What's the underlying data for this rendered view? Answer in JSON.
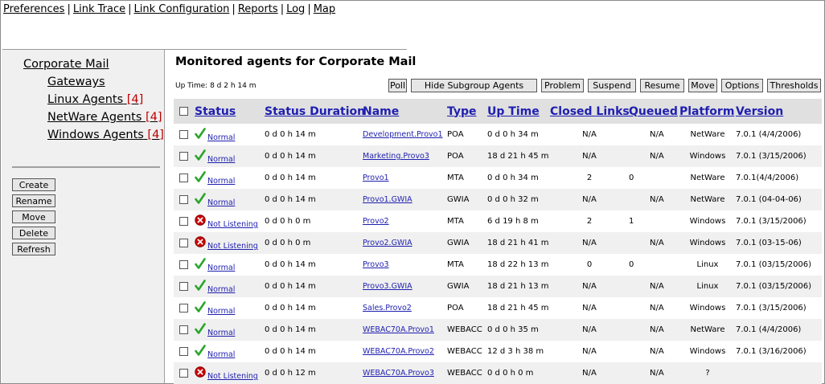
{
  "topnav": [
    "Preferences",
    "Link Trace",
    "Link Configuration",
    "Reports",
    "Log",
    "Map"
  ],
  "tree": {
    "root": "Corporate Mail",
    "children": [
      {
        "label": "Gateways",
        "count": ""
      },
      {
        "label": "Linux Agents",
        "count": "[4]"
      },
      {
        "label": "NetWare Agents",
        "count": "[4]"
      },
      {
        "label": "Windows Agents",
        "count": "[4]"
      }
    ]
  },
  "left_buttons": [
    "Create",
    "Rename",
    "Move",
    "Delete",
    "Refresh"
  ],
  "main": {
    "title": "Monitored agents for Corporate Mail",
    "uptime": "Up Time: 8 d 2 h 14 m",
    "toolbar": [
      "Poll",
      "Hide Subgroup Agents",
      "Problem",
      "Suspend",
      "Resume",
      "Move",
      "Options",
      "Thresholds"
    ]
  },
  "columns": [
    "Status",
    "Status Duration",
    "Name",
    "Type",
    "Up Time",
    "Closed Links",
    "Queued",
    "Platform",
    "Version"
  ],
  "rows": [
    {
      "status": "Normal",
      "ok": true,
      "duration": "0 d 0 h 14 m",
      "name": "Development.Provo1",
      "type": "POA",
      "uptime": "0 d 0 h 34 m",
      "closed": "N/A",
      "queued": "N/A",
      "platform": "NetWare",
      "version": "7.0.1 (4/4/2006)"
    },
    {
      "status": "Normal",
      "ok": true,
      "duration": "0 d 0 h 14 m",
      "name": "Marketing.Provo3",
      "type": "POA",
      "uptime": "18 d 21 h 45 m",
      "closed": "N/A",
      "queued": "N/A",
      "platform": "Windows",
      "version": "7.0.1 (3/15/2006)"
    },
    {
      "status": "Normal",
      "ok": true,
      "duration": "0 d 0 h 14 m",
      "name": "Provo1",
      "type": "MTA",
      "uptime": "0 d 0 h 34 m",
      "closed": "2",
      "queued": "0",
      "platform": "NetWare",
      "version": "7.0.1(4/4/2006)"
    },
    {
      "status": "Normal",
      "ok": true,
      "duration": "0 d 0 h 14 m",
      "name": "Provo1.GWIA",
      "type": "GWIA",
      "uptime": "0 d 0 h 32 m",
      "closed": "N/A",
      "queued": "N/A",
      "platform": "NetWare",
      "version": "7.0.1 (04-04-06)"
    },
    {
      "status": "Not Listening",
      "ok": false,
      "duration": "0 d 0 h 0 m",
      "name": "Provo2",
      "type": "MTA",
      "uptime": "6 d 19 h 8 m",
      "closed": "2",
      "queued": "1",
      "platform": "Windows",
      "version": "7.0.1 (3/15/2006)"
    },
    {
      "status": "Not Listening",
      "ok": false,
      "duration": "0 d 0 h 0 m",
      "name": "Provo2.GWIA",
      "type": "GWIA",
      "uptime": "18 d 21 h 41 m",
      "closed": "N/A",
      "queued": "N/A",
      "platform": "Windows",
      "version": "7.0.1 (03-15-06)"
    },
    {
      "status": "Normal",
      "ok": true,
      "duration": "0 d 0 h 14 m",
      "name": "Provo3",
      "type": "MTA",
      "uptime": "18 d 22 h 13 m",
      "closed": "0",
      "queued": "0",
      "platform": "Linux",
      "version": "7.0.1 (03/15/2006)"
    },
    {
      "status": "Normal",
      "ok": true,
      "duration": "0 d 0 h 14 m",
      "name": "Provo3.GWIA",
      "type": "GWIA",
      "uptime": "18 d 21 h 13 m",
      "closed": "N/A",
      "queued": "N/A",
      "platform": "Linux",
      "version": "7.0.1 (03/15/2006)"
    },
    {
      "status": "Normal",
      "ok": true,
      "duration": "0 d 0 h 14 m",
      "name": "Sales.Provo2",
      "type": "POA",
      "uptime": "18 d 21 h 45 m",
      "closed": "N/A",
      "queued": "N/A",
      "platform": "Windows",
      "version": "7.0.1 (3/15/2006)"
    },
    {
      "status": "Normal",
      "ok": true,
      "duration": "0 d 0 h 14 m",
      "name": "WEBAC70A.Provo1",
      "type": "WEBACC",
      "uptime": "0 d 0 h 35 m",
      "closed": "N/A",
      "queued": "N/A",
      "platform": "NetWare",
      "version": "7.0.1 (4/4/2006)"
    },
    {
      "status": "Normal",
      "ok": true,
      "duration": "0 d 0 h 14 m",
      "name": "WEBAC70A.Provo2",
      "type": "WEBACC",
      "uptime": "12 d 3 h 38 m",
      "closed": "N/A",
      "queued": "N/A",
      "platform": "Windows",
      "version": "7.0.1 (3/16/2006)"
    },
    {
      "status": "Not Listening",
      "ok": false,
      "duration": "0 d 0 h 12 m",
      "name": "WEBAC70A.Provo3",
      "type": "WEBACC",
      "uptime": "0 d 0 h 0 m",
      "closed": "N/A",
      "queued": "N/A",
      "platform": "?",
      "version": ""
    }
  ],
  "colors": {
    "link": "#1f1fb0",
    "ok": "#2aa52a",
    "error": "#cc0000",
    "count": "#c00000",
    "panel": "#f0f0f0"
  }
}
